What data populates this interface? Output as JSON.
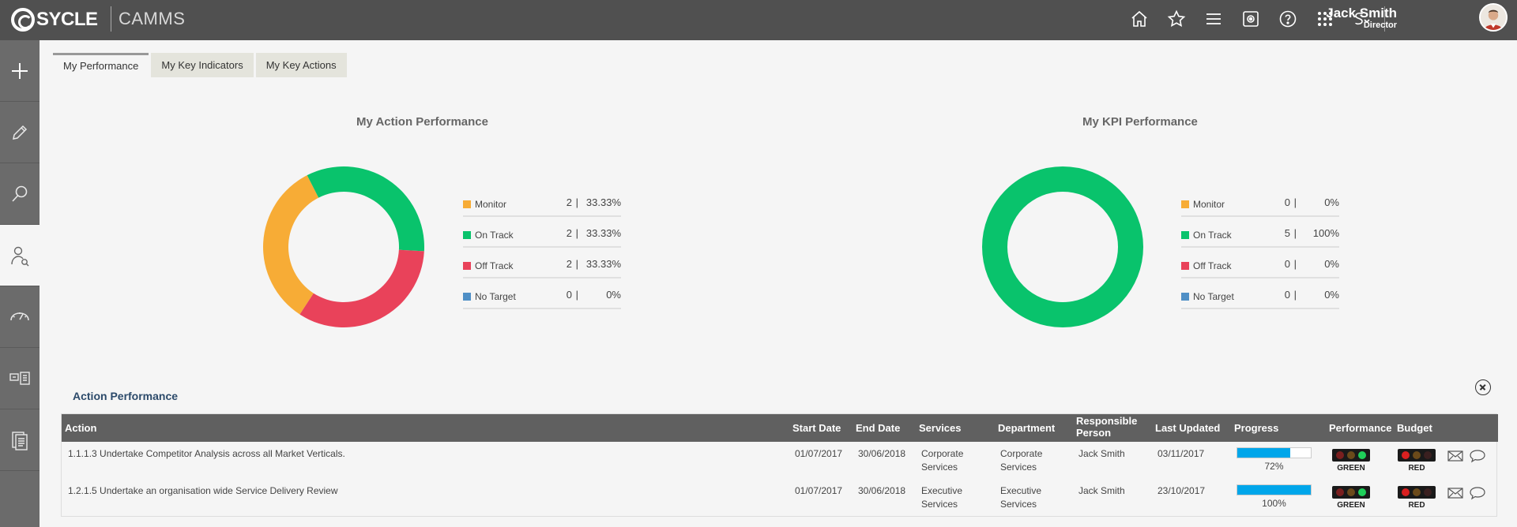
{
  "header": {
    "logo_text": "SYCLE",
    "app_name": "CAMMS",
    "user": {
      "name": "Jack Smith",
      "role": "Director"
    },
    "icons": [
      "home-icon",
      "star-icon",
      "menu-icon",
      "settings-icon",
      "help-icon",
      "apps-grid-icon",
      "sycle-dropdown-icon"
    ]
  },
  "sidebar": {
    "items": [
      {
        "icon": "plus-icon"
      },
      {
        "icon": "pencil-icon"
      },
      {
        "icon": "search-icon"
      },
      {
        "icon": "user-search-icon",
        "active": true
      },
      {
        "icon": "gauge-icon"
      },
      {
        "icon": "dashboard-icon"
      },
      {
        "icon": "report-icon"
      }
    ]
  },
  "tabs": [
    {
      "label": "My Performance",
      "active": true
    },
    {
      "label": "My Key Indicators",
      "active": false
    },
    {
      "label": "My Key Actions",
      "active": false
    }
  ],
  "colors": {
    "monitor": "#f7ac36",
    "on_track": "#09c36c",
    "off_track": "#e9425a",
    "no_target": "#4f8fc6",
    "progress": "#00a6ea"
  },
  "action_chart": {
    "title": "My Action Performance",
    "legend": [
      {
        "label": "Monitor",
        "count": "2",
        "separator": "|",
        "percent": "33.33%"
      },
      {
        "label": "On Track",
        "count": "2",
        "separator": "|",
        "percent": "33.33%"
      },
      {
        "label": "Off Track",
        "count": "2",
        "separator": "|",
        "percent": "33.33%"
      },
      {
        "label": "No Target",
        "count": "0",
        "separator": "|",
        "percent": "0%"
      }
    ]
  },
  "kpi_chart": {
    "title": "My KPI Performance",
    "legend": [
      {
        "label": "Monitor",
        "count": "0",
        "separator": "|",
        "percent": "0%"
      },
      {
        "label": "On Track",
        "count": "5",
        "separator": "|",
        "percent": "100%"
      },
      {
        "label": "Off Track",
        "count": "0",
        "separator": "|",
        "percent": "0%"
      },
      {
        "label": "No Target",
        "count": "0",
        "separator": "|",
        "percent": "0%"
      }
    ]
  },
  "chart_data": [
    {
      "type": "pie",
      "title": "My Action Performance",
      "categories": [
        "Monitor",
        "On Track",
        "Off Track",
        "No Target"
      ],
      "values": [
        2,
        2,
        2,
        0
      ],
      "percents": [
        33.33,
        33.33,
        33.33,
        0
      ],
      "colors": [
        "#f7ac36",
        "#09c36c",
        "#e9425a",
        "#4f8fc6"
      ],
      "legend": "right"
    },
    {
      "type": "pie",
      "title": "My KPI Performance",
      "categories": [
        "Monitor",
        "On Track",
        "Off Track",
        "No Target"
      ],
      "values": [
        0,
        5,
        0,
        0
      ],
      "percents": [
        0,
        100,
        0,
        0
      ],
      "colors": [
        "#f7ac36",
        "#09c36c",
        "#e9425a",
        "#4f8fc6"
      ],
      "legend": "right"
    }
  ],
  "action_performance": {
    "title": "Action Performance",
    "columns": [
      "Action",
      "Start Date",
      "End Date",
      "Services",
      "Department",
      "Responsible Person",
      "Last Updated",
      "Progress",
      "Performance",
      "Budget"
    ],
    "rows": [
      {
        "action": "1.1.1.3 Undertake Competitor Analysis across all Market Verticals.",
        "start": "01/07/2017",
        "end": "30/06/2018",
        "services": "Corporate Services",
        "department": "Corporate Services",
        "person": "Jack Smith",
        "updated": "03/11/2017",
        "progress": 72,
        "progress_text": "72%",
        "performance": "GREEN",
        "budget": "RED"
      },
      {
        "action": "1.2.1.5 Undertake an organisation wide Service Delivery Review",
        "start": "01/07/2017",
        "end": "30/06/2018",
        "services": "Executive Services",
        "department": "Executive Services",
        "person": "Jack Smith",
        "updated": "23/10/2017",
        "progress": 100,
        "progress_text": "100%",
        "performance": "GREEN",
        "budget": "RED"
      }
    ]
  }
}
